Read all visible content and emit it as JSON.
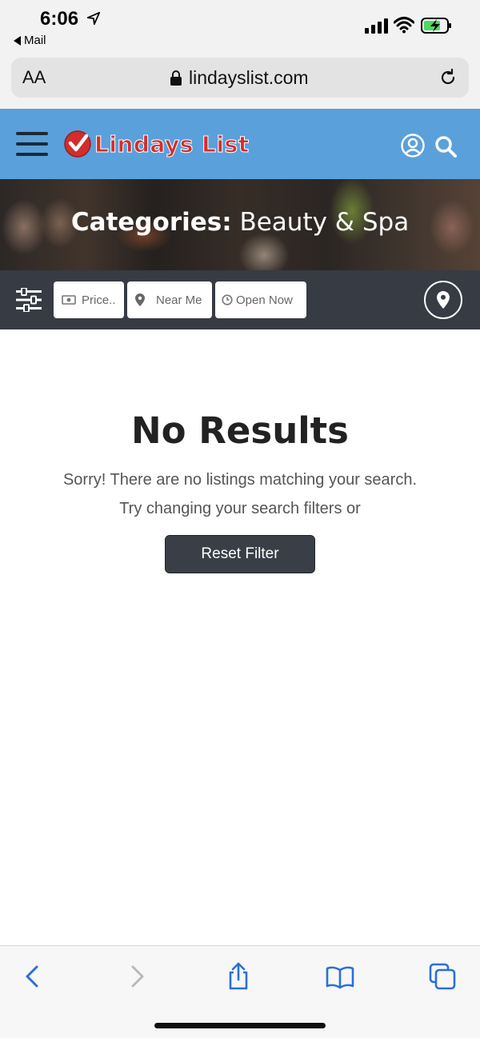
{
  "status_bar": {
    "time": "6:06",
    "back_app": "Mail",
    "icons": [
      "location-arrow-icon",
      "cellular-signal-icon",
      "wifi-icon",
      "battery-charging-icon"
    ],
    "battery_color": "#4cd964"
  },
  "browser": {
    "text_size_label": "AA",
    "domain": "lindayslist.com",
    "icons": [
      "lock-icon",
      "reload-icon"
    ]
  },
  "site_header": {
    "logo_text": "Lindays List",
    "brand_red": "#d32d2d",
    "header_color": "#5aa0db",
    "icons": [
      "hamburger-menu-icon",
      "user-account-icon",
      "search-icon"
    ]
  },
  "hero": {
    "label": "Categories:",
    "category": "Beauty & Spa"
  },
  "filters": {
    "price_label": "Price..",
    "near_me_label": "Near Me",
    "open_now_label": "Open Now",
    "icons": [
      "filter-sliders-icon",
      "money-icon",
      "map-marker-icon",
      "clock-icon",
      "map-pin-icon"
    ],
    "bar_color": "#363b44"
  },
  "main": {
    "title": "No Results",
    "message_line1": "Sorry! There are no listings matching your search.",
    "message_line2": "Try changing your search filters or",
    "reset_button": "Reset Filter"
  },
  "toolbar": {
    "icons": [
      "back-icon",
      "forward-icon",
      "share-icon",
      "bookmarks-icon",
      "tabs-icon"
    ],
    "accent_color": "#2a6fd6"
  }
}
